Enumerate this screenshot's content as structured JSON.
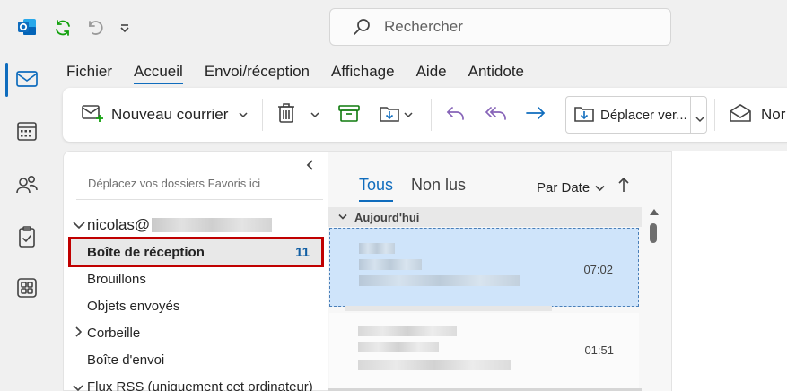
{
  "colors": {
    "accent": "#0f6cbd",
    "highlight": "#c00000",
    "selection": "#cfe4fa",
    "count": "#115ea3"
  },
  "titlebar": {
    "icons": [
      "outlook-app-icon",
      "sync-icon",
      "undo-icon",
      "quick-access-dropdown-icon"
    ],
    "search": {
      "placeholder": "Rechercher",
      "icon": "search-icon"
    }
  },
  "rail": {
    "items": [
      {
        "name": "mail",
        "icon": "mail-icon",
        "active": true
      },
      {
        "name": "calendar",
        "icon": "calendar-icon",
        "active": false
      },
      {
        "name": "people",
        "icon": "people-icon",
        "active": false
      },
      {
        "name": "tasks",
        "icon": "clipboard-check-icon",
        "active": false
      },
      {
        "name": "apps",
        "icon": "apps-grid-icon",
        "active": false
      }
    ]
  },
  "menu": {
    "tabs": [
      {
        "label": "Fichier",
        "active": false
      },
      {
        "label": "Accueil",
        "active": true
      },
      {
        "label": "Envoi/réception",
        "active": false
      },
      {
        "label": "Affichage",
        "active": false
      },
      {
        "label": "Aide",
        "active": false
      },
      {
        "label": "Antidote",
        "active": false
      }
    ]
  },
  "ribbon": {
    "new_mail_label": "Nouveau courrier",
    "move_label": "Déplacer ver...",
    "next_label": "Nor",
    "icons": [
      "new-mail-icon",
      "delete-icon",
      "archive-icon",
      "move-to-folder-icon",
      "reply-icon",
      "reply-all-icon",
      "forward-icon",
      "move-icon",
      "envelope-open-icon"
    ]
  },
  "folders": {
    "favorites_hint": "Déplacez vos dossiers Favoris ici",
    "account": "nicolas@",
    "inbox": {
      "label": "Boîte de réception",
      "count": "11"
    },
    "items": [
      "Brouillons",
      "Objets envoyés",
      "Corbeille",
      "Boîte d'envoi",
      "Flux RSS (uniquement cet ordinateur)"
    ]
  },
  "list": {
    "tabs": [
      {
        "label": "Tous",
        "active": true
      },
      {
        "label": "Non lus",
        "active": false
      }
    ],
    "sort_label": "Par Date",
    "group_label": "Aujourd'hui",
    "messages": [
      {
        "time": "07:02",
        "selected": true
      },
      {
        "time": "01:51",
        "selected": false
      }
    ]
  }
}
